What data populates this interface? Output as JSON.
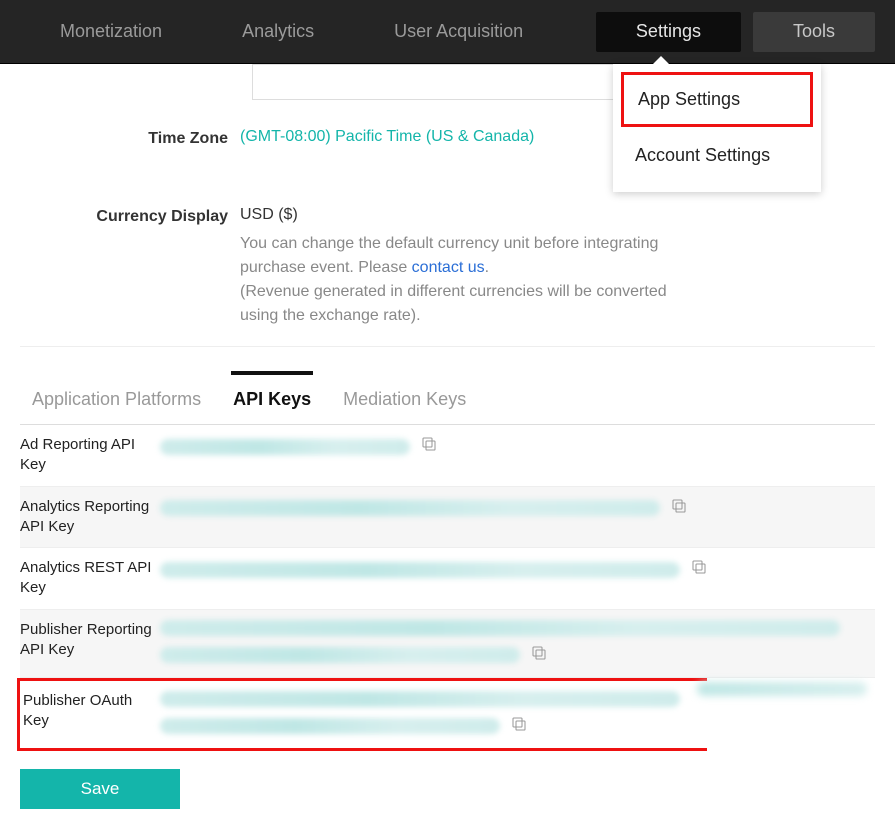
{
  "nav": {
    "monetization": "Monetization",
    "analytics": "Analytics",
    "user_acquisition": "User Acquisition",
    "settings": "Settings",
    "tools": "Tools"
  },
  "dropdown": {
    "app_settings": "App Settings",
    "account_settings": "Account Settings"
  },
  "form": {
    "timezone_label": "Time Zone",
    "timezone_value": "(GMT-08:00) Pacific Time (US & Canada)",
    "currency_label": "Currency Display",
    "currency_value": "USD ($)",
    "currency_help_1": "You can change the default currency unit before integrating purchase event. Please ",
    "currency_help_link": "contact us",
    "currency_help_1b": ".",
    "currency_help_2": "(Revenue generated in different currencies will be converted using the exchange rate)."
  },
  "tabs": {
    "platforms": "Application Platforms",
    "api_keys": "API Keys",
    "mediation": "Mediation Keys"
  },
  "api": {
    "ad_reporting": "Ad Reporting API Key",
    "analytics_reporting": "Analytics Reporting API Key",
    "analytics_rest": "Analytics REST API Key",
    "publisher_reporting": "Publisher Reporting API Key",
    "publisher_oauth": "Publisher OAuth Key"
  },
  "buttons": {
    "save": "Save"
  }
}
